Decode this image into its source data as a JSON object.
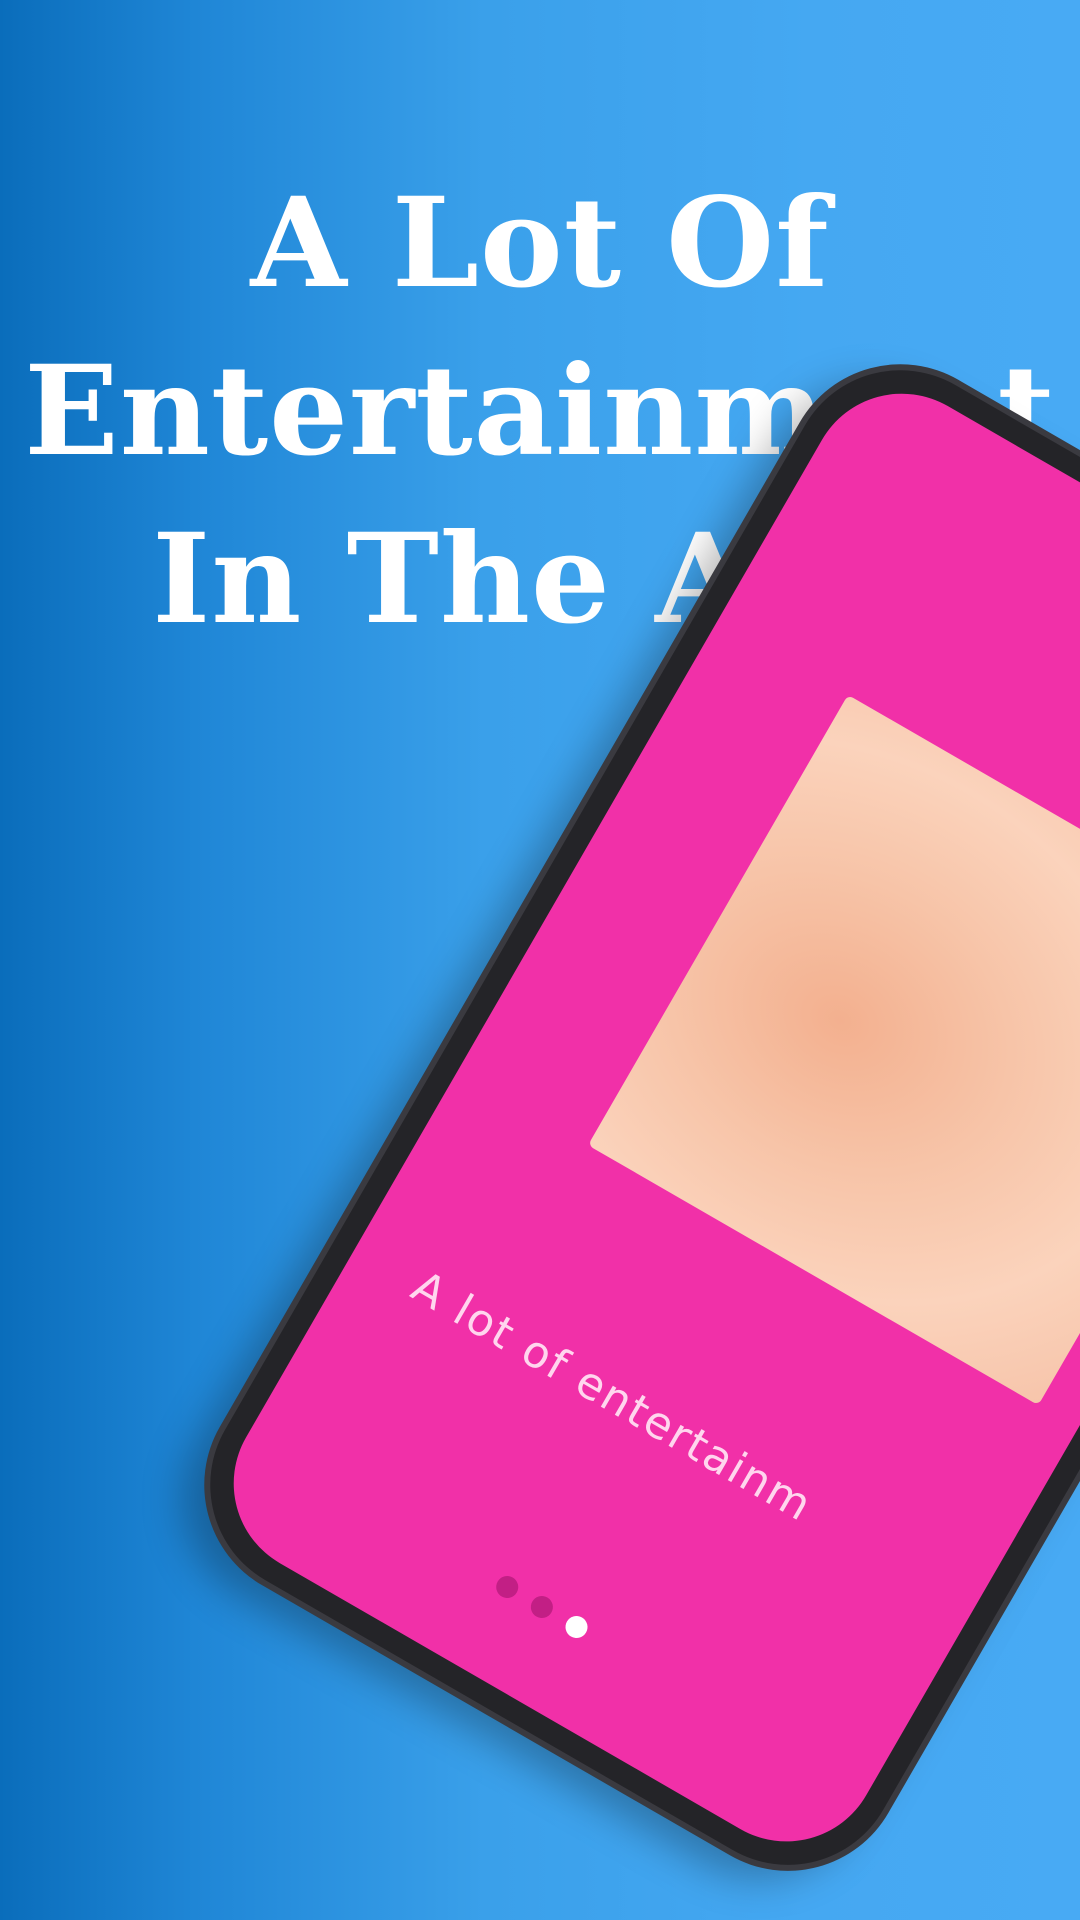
{
  "headline": {
    "line1": "A Lot Of",
    "line2": "Entertainment",
    "line3": "In The App"
  },
  "phone_screen": {
    "caption": "A lot of entertainm",
    "pager": {
      "total_visible": 3,
      "active_index": 2
    }
  },
  "colors": {
    "background_left": "#0a6dbb",
    "background_right": "#48aaf4",
    "screen": "#f130a8",
    "headline_text": "#ffffff"
  }
}
